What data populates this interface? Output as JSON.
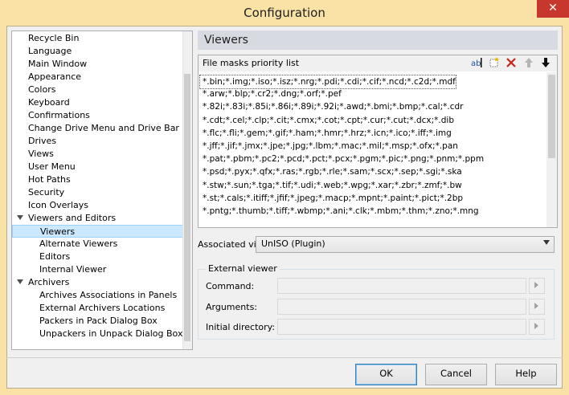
{
  "window": {
    "title": "Configuration",
    "close_glyph": "✕"
  },
  "tree": {
    "items": [
      {
        "label": "Recycle Bin"
      },
      {
        "label": "Language"
      },
      {
        "label": "Main Window"
      },
      {
        "label": "Appearance"
      },
      {
        "label": "Colors"
      },
      {
        "label": "Keyboard"
      },
      {
        "label": "Confirmations"
      },
      {
        "label": "Change Drive Menu and Drive Bar"
      },
      {
        "label": "Drives"
      },
      {
        "label": "Views"
      },
      {
        "label": "User Menu"
      },
      {
        "label": "Hot Paths"
      },
      {
        "label": "Security"
      },
      {
        "label": "Icon Overlays"
      },
      {
        "label": "Viewers and Editors",
        "expanded": true
      },
      {
        "label": "Viewers",
        "selected": true
      },
      {
        "label": "Alternate Viewers"
      },
      {
        "label": "Editors"
      },
      {
        "label": "Internal Viewer"
      },
      {
        "label": "Archivers",
        "expanded": true
      },
      {
        "label": "Archives Associations in Panels"
      },
      {
        "label": "External Archivers Locations"
      },
      {
        "label": "Packers in Pack Dialog Box"
      },
      {
        "label": "Unpackers in Unpack Dialog Box"
      }
    ]
  },
  "panel": {
    "title": "Viewers",
    "masks_caption": "File masks priority list",
    "toolbar": {
      "rename_icon": "rename-icon",
      "new_icon": "new-item-icon",
      "delete_icon": "delete-icon",
      "up_icon": "arrow-up-icon",
      "down_icon": "arrow-down-icon"
    },
    "masks": [
      "*.bin;*.img;*.iso;*.isz;*.nrg;*.pdi;*.cdi;*.cif;*.ncd;*.c2d;*.mdf",
      "*.arw;*.blp;*.cr2;*.dng;*.orf;*.pef",
      "*.82i;*.83i;*.85i;*.86i;*.89i;*.92i;*.awd;*.bmi;*.bmp;*.cal;*.cdr",
      "*.cdt;*.cel;*.clp;*.cit;*.cmx;*.cot;*.cpt;*.cur;*.cut;*.dcx;*.dib",
      "*.flc;*.fli;*.gem;*.gif;*.ham;*.hmr;*.hrz;*.icn;*.ico;*.iff;*.img",
      "*.jff;*.jif;*.jmx;*.jpe;*.jpg;*.lbm;*.mac;*.mil;*.msp;*.ofx;*.pan",
      "*.pat;*.pbm;*.pc2;*.pcd;*.pct;*.pcx;*.pgm;*.pic;*.png;*.pnm;*.ppm",
      "*.psd;*.pyx;*.qfx;*.ras;*.rgb;*.rle;*.sam;*.scx;*.sep;*.sgi;*.ska",
      "*.stw;*.sun;*.tga;*.tif;*.udi;*.web;*.wpg;*.xar;*.zbr;*.zmf;*.bw",
      "*.st;*.cals;*.itiff;*.jfif;*.jpeg;*.macp;*.mpnt;*.paint;*.pict;*.2bp",
      "*.pntg;*.thumb;*.tiff;*.wbmp;*.ani;*.clk;*.mbm;*.thm;*.zno;*.mng"
    ],
    "associated_label": "Associated viewer:",
    "associated_value": "UnISO (Plugin)",
    "external_legend": "External viewer",
    "command_label": "Command:",
    "arguments_label": "Arguments:",
    "initial_dir_label": "Initial directory:",
    "command_value": "",
    "arguments_value": "",
    "initial_dir_value": ""
  },
  "buttons": {
    "ok": "OK",
    "cancel": "Cancel",
    "help": "Help"
  }
}
